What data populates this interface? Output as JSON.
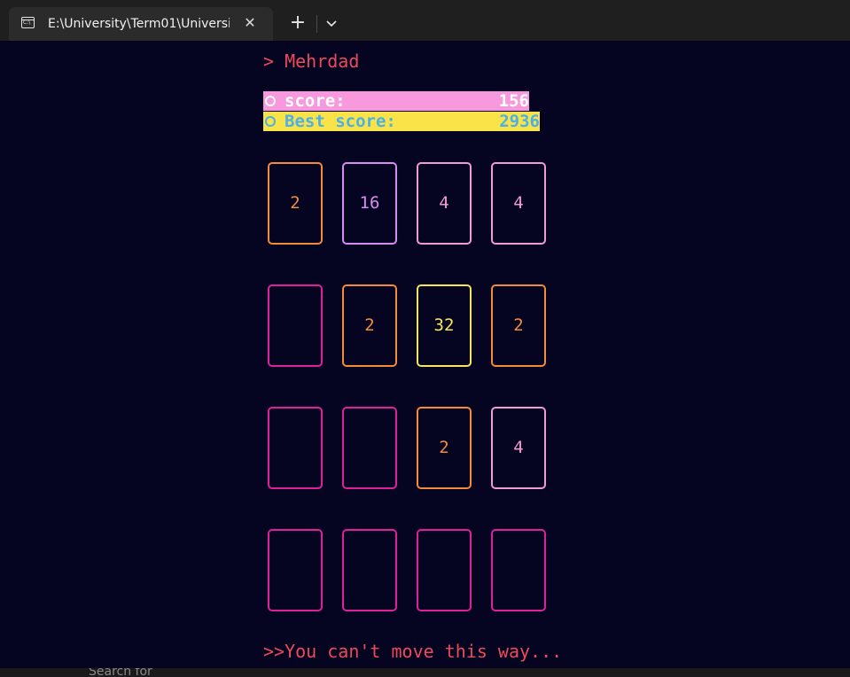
{
  "window": {
    "tab_title": "E:\\University\\Term01\\Universi",
    "icon": "terminal-icon",
    "icon_text": "C:\\",
    "close_glyph": "✕",
    "new_tab_glyph": "+"
  },
  "player": {
    "prompt": "> Mehrdad"
  },
  "scores": {
    "current_label": "score:",
    "current_value": "156",
    "best_label": "Best score:",
    "best_value": "2936"
  },
  "board": {
    "rows": [
      [
        "2",
        "16",
        "4",
        "4"
      ],
      [
        "",
        "2",
        "32",
        "2"
      ],
      [
        "",
        "",
        "2",
        "4"
      ],
      [
        "",
        "",
        "",
        ""
      ]
    ]
  },
  "tile_colors": {
    "empty": "#e0209a",
    "2": "#f58a3a",
    "4": "#f29ad6",
    "16": "#d98af5",
    "32": "#f9e55a"
  },
  "message": ">>You can't move this way...",
  "background_app": {
    "search_text": "Search for"
  }
}
